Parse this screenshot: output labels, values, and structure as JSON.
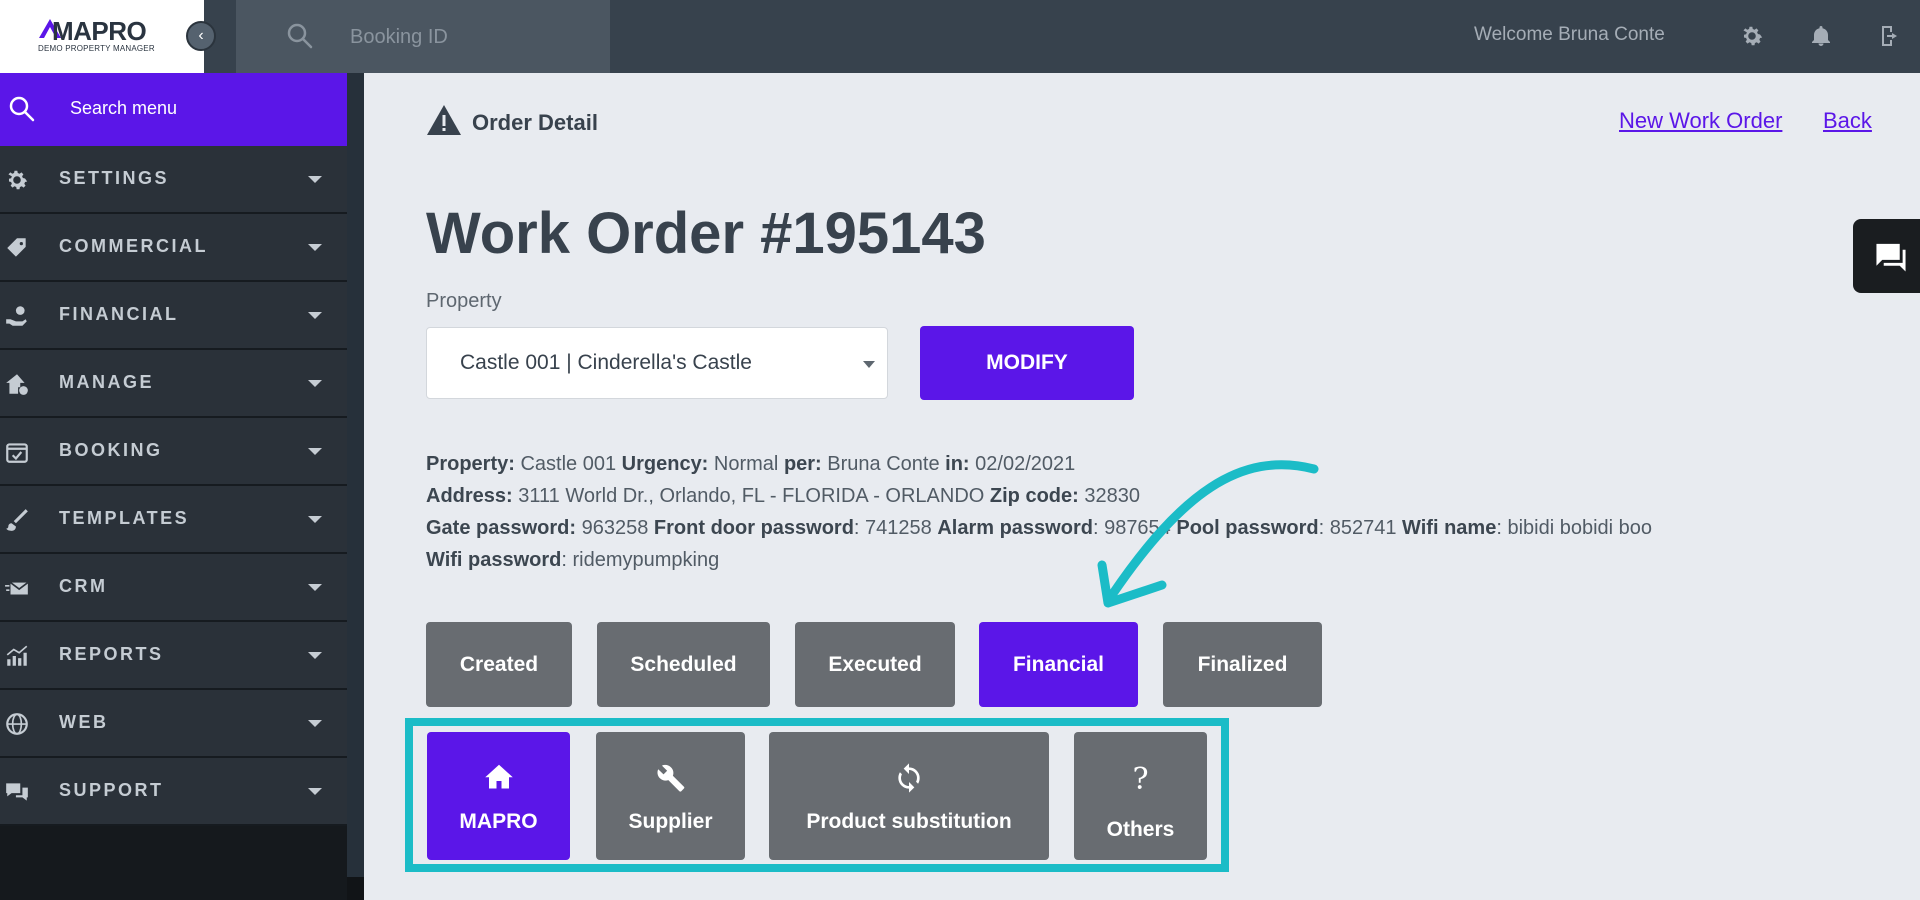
{
  "brand": {
    "name": "MAPRO",
    "tagline": "DEMO PROPERTY MANAGER"
  },
  "topbar": {
    "search_placeholder": "Booking ID",
    "welcome_text": "Welcome Bruna Conte",
    "icons": [
      "gear-icon",
      "bell-icon",
      "logout-icon"
    ]
  },
  "sidebar": {
    "search_label": "Search menu",
    "items": [
      {
        "label": "SETTINGS",
        "icon": "gear-icon"
      },
      {
        "label": "COMMERCIAL",
        "icon": "tag-icon"
      },
      {
        "label": "FINANCIAL",
        "icon": "money-hand-icon"
      },
      {
        "label": "MANAGE",
        "icon": "house-gear-icon"
      },
      {
        "label": "BOOKING",
        "icon": "calendar-check-icon"
      },
      {
        "label": "TEMPLATES",
        "icon": "brush-icon"
      },
      {
        "label": "CRM",
        "icon": "envelope-icon"
      },
      {
        "label": "REPORTS",
        "icon": "chart-icon"
      },
      {
        "label": "WEB",
        "icon": "globe-icon"
      },
      {
        "label": "SUPPORT",
        "icon": "chat-bubbles-icon"
      }
    ]
  },
  "header": {
    "section_title": "Order Detail",
    "new_work_order_link": "New Work Order",
    "back_link": "Back"
  },
  "work_order": {
    "title": "Work Order #195143",
    "property_label": "Property",
    "property_value": "Castle 001 | Cinderella's Castle",
    "modify_label": "MODIFY"
  },
  "details": {
    "property_key": "Property:",
    "property_val": "Castle 001",
    "urgency_key": "Urgency:",
    "urgency_val": "Normal",
    "per_key": "per:",
    "per_val": "Bruna Conte",
    "in_key": "in:",
    "in_val": "02/02/2021",
    "address_key": "Address:",
    "address_val": "3111 World Dr., Orlando, FL - FLORIDA - ORLANDO",
    "zip_key": "Zip code:",
    "zip_val": "32830",
    "gate_key": "Gate password:",
    "gate_val": "963258",
    "front_key": "Front door password",
    "front_val": ": 741258",
    "alarm_key": "Alarm password",
    "alarm_val": ": 987654",
    "pool_key": "Pool password",
    "pool_val": ": 852741",
    "wifi_name_key": "Wifi name",
    "wifi_name_val": ": bibidi bobidi boo",
    "wifi_pass_key": "Wifi password",
    "wifi_pass_val": ": ridemypumpking"
  },
  "status_tabs": [
    {
      "label": "Created",
      "active": false
    },
    {
      "label": "Scheduled",
      "active": false
    },
    {
      "label": "Executed",
      "active": false
    },
    {
      "label": "Financial",
      "active": true
    },
    {
      "label": "Finalized",
      "active": false
    }
  ],
  "cost_categories": [
    {
      "label": "MAPRO",
      "icon": "home-icon",
      "active": true
    },
    {
      "label": "Supplier",
      "icon": "wrench-icon",
      "active": false
    },
    {
      "label": "Product substitution",
      "icon": "refresh-icon",
      "active": false
    },
    {
      "label": "Others",
      "icon": "question-icon",
      "active": false
    }
  ],
  "colors": {
    "accent": "#5b16e8",
    "topbar": "#37424d",
    "highlight": "#1bbcc7",
    "tab_inactive": "#686c71"
  }
}
